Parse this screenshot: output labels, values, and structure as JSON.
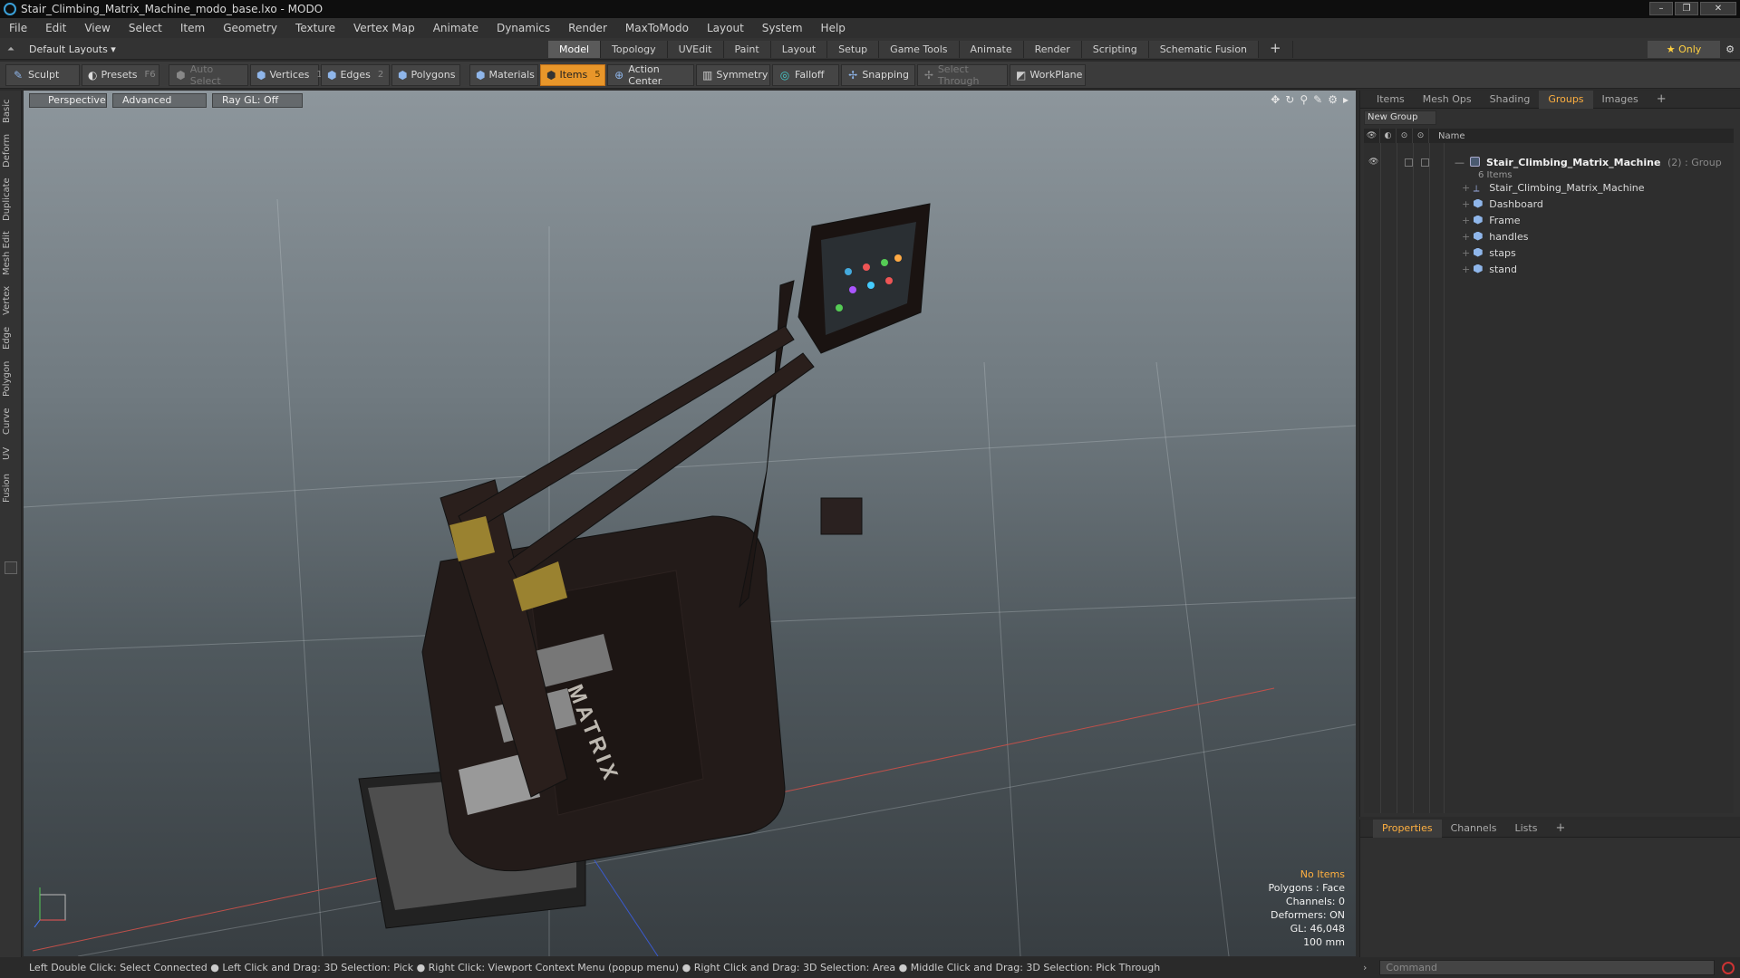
{
  "window": {
    "title": "Stair_Climbing_Matrix_Machine_modo_base.lxo - MODO",
    "min": "–",
    "max": "❐",
    "close": "✕"
  },
  "menu": [
    "File",
    "Edit",
    "View",
    "Select",
    "Item",
    "Geometry",
    "Texture",
    "Vertex Map",
    "Animate",
    "Dynamics",
    "Render",
    "MaxToModo",
    "Layout",
    "System",
    "Help"
  ],
  "layout": {
    "label": "Default Layouts ▾"
  },
  "mode_tabs": [
    "Model",
    "Topology",
    "UVEdit",
    "Paint",
    "Layout",
    "Setup",
    "Game Tools",
    "Animate",
    "Render",
    "Scripting",
    "Schematic Fusion"
  ],
  "mode_tab_active": "Model",
  "only_label": "Only",
  "toolbar": {
    "sculpt": "Sculpt",
    "presets": "Presets",
    "presets_key": "F6",
    "auto_select": "Auto Select",
    "vertices": "Vertices",
    "vertices_key": "1",
    "edges": "Edges",
    "edges_key": "2",
    "polygons": "Polygons",
    "materials": "Materials",
    "items": "Items",
    "items_key": "5",
    "action_center": "Action Center",
    "symmetry": "Symmetry",
    "falloff": "Falloff",
    "snapping": "Snapping",
    "select_through": "Select Through",
    "workplane": "WorkPlane"
  },
  "left_tabs": [
    "Basic",
    "Deform",
    "Duplicate",
    "Mesh Edit",
    "Vertex",
    "Edge",
    "Polygon",
    "Curve",
    "UV",
    "Fusion"
  ],
  "viewport": {
    "perspective": "Perspective",
    "advanced": "Advanced",
    "raygl": "Ray GL: Off",
    "brand": "MATRIX",
    "info": {
      "selection": "No Items",
      "polygons": "Polygons : Face",
      "channels": "Channels: 0",
      "deformers": "Deformers: ON",
      "gl": "GL: 46,048",
      "scale": "100 mm"
    }
  },
  "groups_panel": {
    "tabs": [
      "Items",
      "Mesh Ops",
      "Shading",
      "Groups",
      "Images"
    ],
    "active_tab": "Groups",
    "new_group": "New Group",
    "name_header": "Name",
    "root": {
      "name": "Stair_Climbing_Matrix_Machine",
      "suffix": "(2) : Group",
      "count": "6 Items"
    },
    "children": [
      "Stair_Climbing_Matrix_Machine",
      "Dashboard",
      "Frame",
      "handles",
      "staps",
      "stand"
    ]
  },
  "props_panel": {
    "tabs": [
      "Properties",
      "Channels",
      "Lists"
    ],
    "active_tab": "Properties"
  },
  "command": {
    "placeholder": "Command"
  },
  "status": "Left Double Click: Select Connected ● Left Click and Drag: 3D Selection: Pick ● Right Click: Viewport Context Menu (popup menu) ● Right Click and Drag: 3D Selection: Area ● Middle Click and Drag: 3D Selection: Pick Through"
}
